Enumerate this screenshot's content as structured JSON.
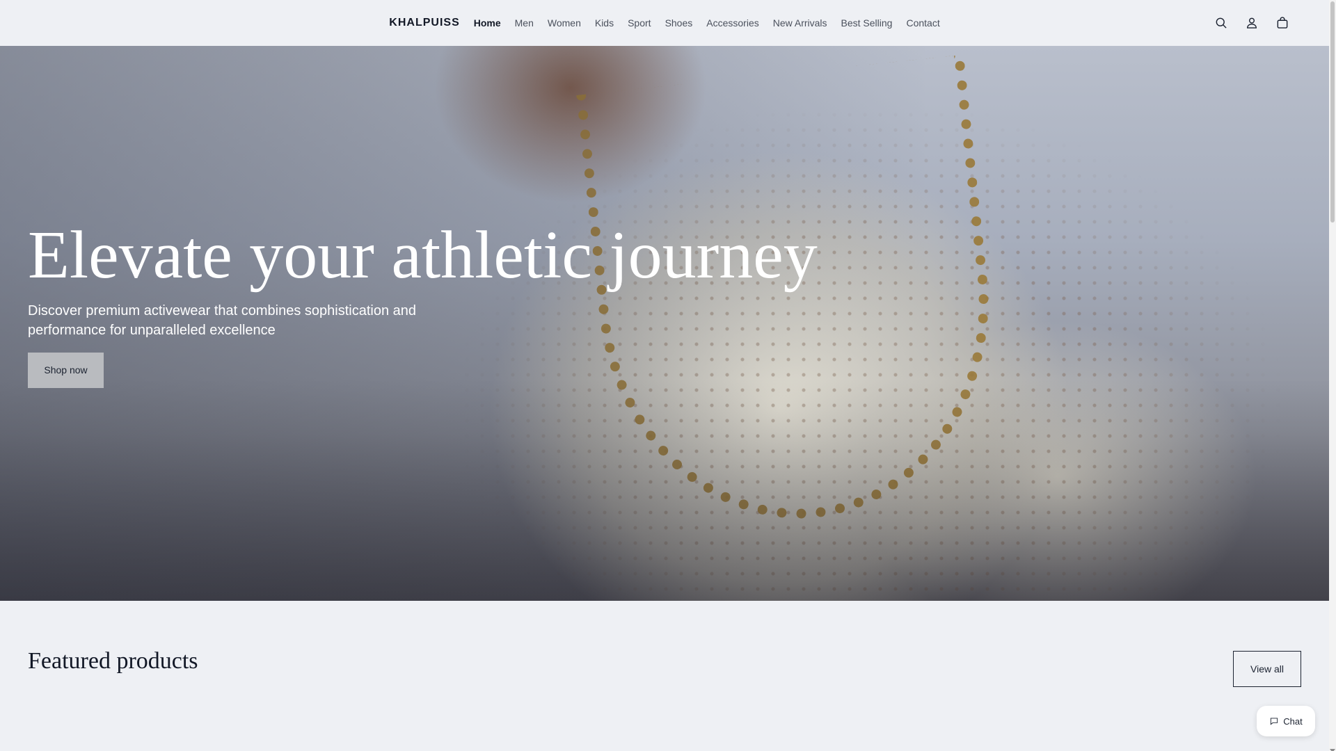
{
  "header": {
    "logo": "KHALPUISS",
    "nav": [
      {
        "label": "Home",
        "active": true
      },
      {
        "label": "Men"
      },
      {
        "label": "Women"
      },
      {
        "label": "Kids"
      },
      {
        "label": "Sport"
      },
      {
        "label": "Shoes"
      },
      {
        "label": "Accessories"
      },
      {
        "label": "New Arrivals"
      },
      {
        "label": "Best Selling"
      },
      {
        "label": "Contact"
      }
    ],
    "icons": [
      "search-icon",
      "account-icon",
      "cart-icon"
    ]
  },
  "hero": {
    "title": "Elevate your athletic journey",
    "subtitle": "Discover premium activewear that combines sophistication and performance for unparalleled excellence",
    "button": "Shop now"
  },
  "featured": {
    "title": "Featured products",
    "view_all": "View all"
  },
  "chat": {
    "label": "Chat"
  },
  "colors": {
    "background": "#eef0f4",
    "text": "#121826",
    "hero_button": "#b9bbbf"
  }
}
